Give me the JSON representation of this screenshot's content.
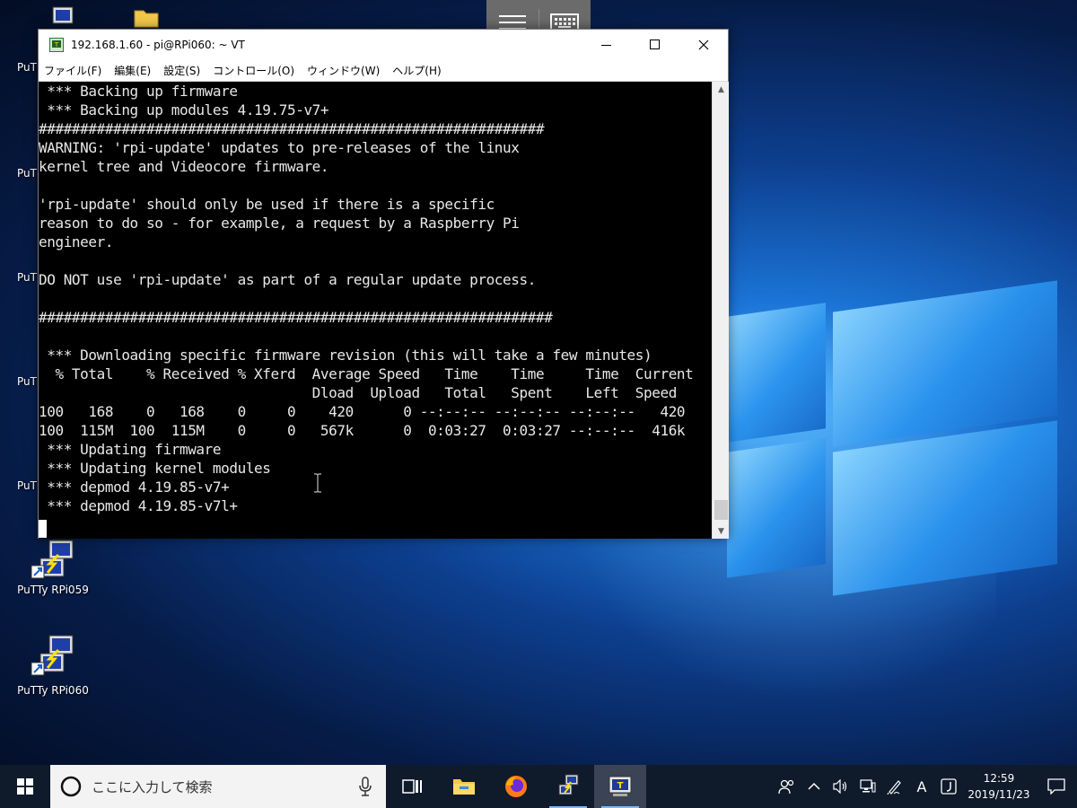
{
  "window": {
    "title": "192.168.1.60 - pi@RPi060: ~ VT",
    "menu": [
      "ファイル(F)",
      "編集(E)",
      "設定(S)",
      "コントロール(O)",
      "ウィンドウ(W)",
      "ヘルプ(H)"
    ]
  },
  "terminal": {
    "lines": [
      " *** Backing up firmware",
      " *** Backing up modules 4.19.75-v7+",
      "#############################################################",
      "WARNING: 'rpi-update' updates to pre-releases of the linux",
      "kernel tree and Videocore firmware.",
      "",
      "'rpi-update' should only be used if there is a specific",
      "reason to do so - for example, a request by a Raspberry Pi",
      "engineer.",
      "",
      "DO NOT use 'rpi-update' as part of a regular update process.",
      "",
      "##############################################################",
      "",
      " *** Downloading specific firmware revision (this will take a few minutes)",
      "  % Total    % Received % Xferd  Average Speed   Time    Time     Time  Current",
      "                                 Dload  Upload   Total   Spent    Left  Speed",
      "100   168    0   168    0     0    420      0 --:--:-- --:--:-- --:--:--   420",
      "100  115M  100  115M    0     0   567k      0  0:03:27  0:03:27 --:--:--  416k",
      " *** Updating firmware",
      " *** Updating kernel modules",
      " *** depmod 4.19.85-v7+",
      " *** depmod 4.19.85-v7l+"
    ]
  },
  "desktop_icons": [
    {
      "label": "PuTTy RPi059"
    },
    {
      "label": "PuTTy RPi060"
    },
    {
      "label": "PuT"
    },
    {
      "label": "PuT"
    },
    {
      "label": "PuT"
    },
    {
      "label": "PuT"
    },
    {
      "label": "PuT"
    }
  ],
  "taskbar": {
    "search_placeholder": "ここに入力して検索",
    "time": "12:59",
    "date": "2019/11/23",
    "ime_label": "A"
  },
  "colors": {
    "terminal_bg": "#000000",
    "terminal_fg": "#e8e8e8",
    "taskbar_bg": "#0f1a2b"
  },
  "icons": {
    "start": "windows-logo-icon",
    "search": "cortana-circle-icon",
    "mic": "microphone-icon",
    "taskview": "task-view-icon",
    "explorer": "folder-icon",
    "firefox": "firefox-icon",
    "putty": "putty-icon",
    "teraterm": "teraterm-icon"
  }
}
